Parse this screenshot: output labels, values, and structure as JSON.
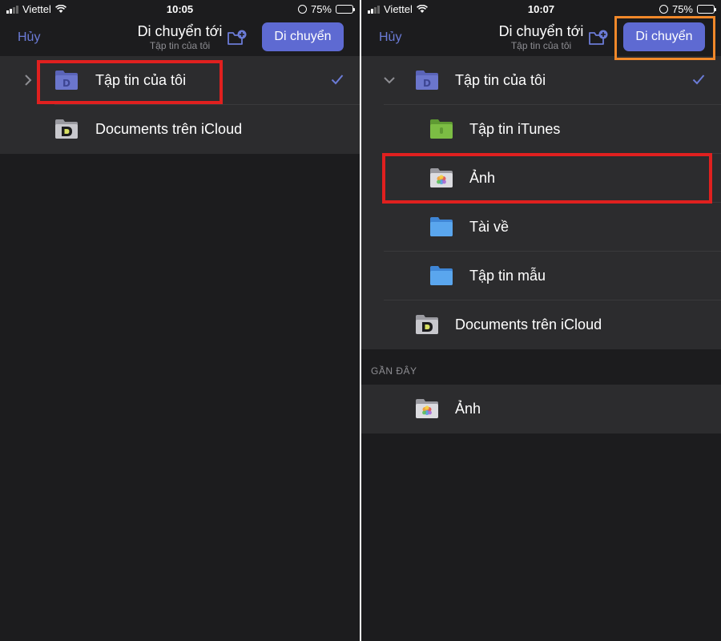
{
  "screens": [
    {
      "status": {
        "carrier": "Viettel",
        "time": "10:05",
        "battery": "75%",
        "battery_level": 0.75
      },
      "nav": {
        "cancel_label": "Hủy",
        "title": "Di chuyển tới",
        "subtitle": "Tập tin của tôi",
        "move_label": "Di chuyển"
      },
      "rows": [
        {
          "label": "Tập tin của tôi",
          "icon": "documents-folder-icon",
          "selected": true,
          "expanded": false
        },
        {
          "label": "Documents trên iCloud",
          "icon": "icloud-documents-folder-icon"
        }
      ]
    },
    {
      "status": {
        "carrier": "Viettel",
        "time": "10:07",
        "battery": "75%",
        "battery_level": 0.75
      },
      "nav": {
        "cancel_label": "Hủy",
        "title": "Di chuyển tới",
        "subtitle": "Tập tin của tôi",
        "move_label": "Di chuyển"
      },
      "rows": [
        {
          "label": "Tập tin của tôi",
          "icon": "documents-folder-icon",
          "selected": true,
          "expanded": true
        },
        {
          "label": "Tập tin iTunes",
          "icon": "itunes-folder-icon"
        },
        {
          "label": "Ảnh",
          "icon": "photos-folder-icon"
        },
        {
          "label": "Tài về",
          "icon": "folder-icon"
        },
        {
          "label": "Tập tin mẫu",
          "icon": "folder-icon"
        },
        {
          "label": "Documents trên iCloud",
          "icon": "icloud-documents-folder-icon"
        }
      ],
      "recent": {
        "header": "GẦN ĐÂY",
        "rows": [
          {
            "label": "Ảnh",
            "icon": "photos-folder-icon"
          }
        ]
      }
    }
  ],
  "colors": {
    "accent": "#5e6ad2",
    "link": "#6b7bd6",
    "background": "#1c1c1e",
    "row_background": "#2c2c2e",
    "highlight_red": "#e0201f",
    "highlight_orange": "#f0882a"
  }
}
